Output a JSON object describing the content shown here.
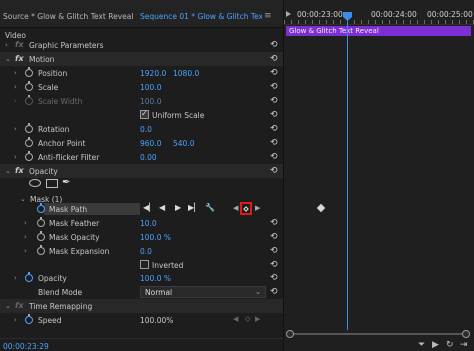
{
  "tabs": {
    "source": "Source * Glow & Glitch Text Reveal",
    "sequence": "Sequence 01 * Glow & Glitch Text R...",
    "menu_icon": "hamburger-icon"
  },
  "timeline": {
    "timecodes": [
      "00:00:23:00",
      "00:00:24:00",
      "00:00:25:00"
    ],
    "clip_name": "Glow & Glitch Text Reveal",
    "clip_color": "#7d2fd4",
    "playhead_color": "#3b8de6"
  },
  "effects": {
    "video_label": "Video",
    "graphic_parameters": "Graphic Parameters",
    "motion": {
      "label": "Motion",
      "position": {
        "label": "Position",
        "x": "1920.0",
        "y": "1080.0"
      },
      "scale": {
        "label": "Scale",
        "value": "100.0"
      },
      "scale_width": {
        "label": "Scale Width",
        "value": "100.0"
      },
      "uniform_scale": "Uniform Scale",
      "rotation": {
        "label": "Rotation",
        "value": "0.0"
      },
      "anchor_point": {
        "label": "Anchor Point",
        "x": "960.0",
        "y": "540.0"
      },
      "anti_flicker": {
        "label": "Anti-flicker Filter",
        "value": "0.00"
      }
    },
    "opacity": {
      "label": "Opacity",
      "mask": "Mask (1)",
      "mask_path": "Mask Path",
      "mask_feather": {
        "label": "Mask Feather",
        "value": "10.0"
      },
      "mask_opacity": {
        "label": "Mask Opacity",
        "value": "100.0 %"
      },
      "mask_expansion": {
        "label": "Mask Expansion",
        "value": "0.0"
      },
      "inverted": "Inverted",
      "opacity_value": {
        "label": "Opacity",
        "value": "100.0 %"
      },
      "blend_mode": {
        "label": "Blend Mode",
        "value": "Normal"
      }
    },
    "time_remapping": {
      "label": "Time Remapping",
      "speed": {
        "label": "Speed",
        "value": "100.00%"
      }
    }
  },
  "status": {
    "timecode": "00:00:23:29"
  },
  "highlight_color": "#e01a1a",
  "value_color": "#4aa3ff"
}
